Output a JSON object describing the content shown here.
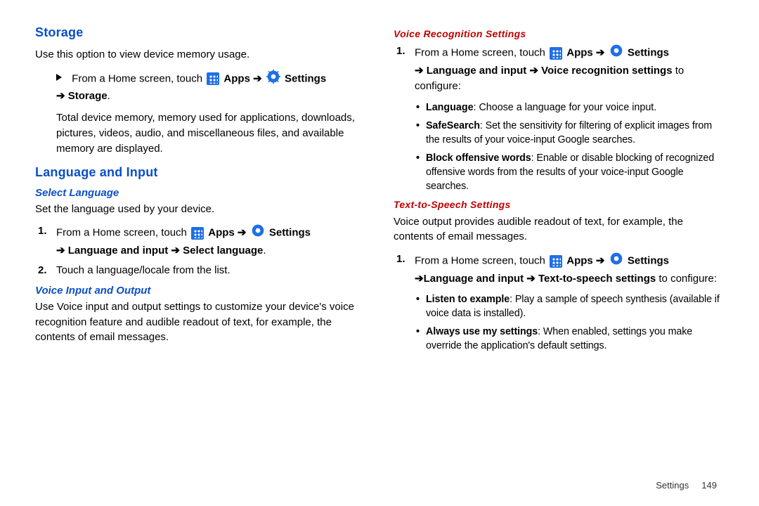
{
  "left": {
    "h_storage": "Storage",
    "p_storage_intro": "Use this option to view device memory usage.",
    "p_from_home": "From a Home screen, touch",
    "lbl_apps": "Apps",
    "lbl_settings": "Settings",
    "lbl_storage_path": "➔ Storage",
    "p_storage_desc": "Total device memory, memory used for applications, downloads, pictures, videos, audio, and miscellaneous files, and available memory are displayed.",
    "h_lang": "Language and Input",
    "h_select_lang": "Select Language",
    "p_select_lang_intro": "Set the language used by your device.",
    "step1_a": "From a Home screen, touch",
    "step1_b_path": "➔ Language and input ➔ Select language",
    "step2": "Touch a language/locale from the list.",
    "h_voice_io": "Voice Input and Output",
    "p_voice_io": "Use Voice input and output settings to customize your device's voice recognition feature and audible readout of text, for example, the contents of email messages."
  },
  "right": {
    "h_vrs": "Voice Recognition Settings",
    "step1_a": "From a Home screen, touch",
    "path_vrs": "➔ Language and input ➔ Voice recognition settings",
    "to_configure": " to configure:",
    "b_language_k": "Language",
    "b_language_v": ": Choose a language for your voice input.",
    "b_safesearch_k": "SafeSearch",
    "b_safesearch_v": ": Set the sensitivity for filtering of explicit images from the results of your voice-input Google searches.",
    "b_block_k": "Block offensive words",
    "b_block_v": ": Enable or disable blocking of recognized offensive words from the results of your voice-input Google searches.",
    "h_tts": "Text-to-Speech Settings",
    "p_tts_intro": "Voice output provides audible readout of text, for example, the contents of email messages.",
    "path_tts": "➔Language and input ➔ Text-to-speech settings",
    "b_listen_k": "Listen to example",
    "b_listen_v": ": Play a sample of speech synthesis (available if voice data is installed).",
    "b_always_k": "Always use my settings",
    "b_always_v": ": When enabled, settings you make override the application's default settings.",
    "lbl_apps": "Apps",
    "lbl_settings": "Settings"
  },
  "footer": {
    "section": "Settings",
    "page": "149"
  },
  "arrow": "➔",
  "period": "."
}
